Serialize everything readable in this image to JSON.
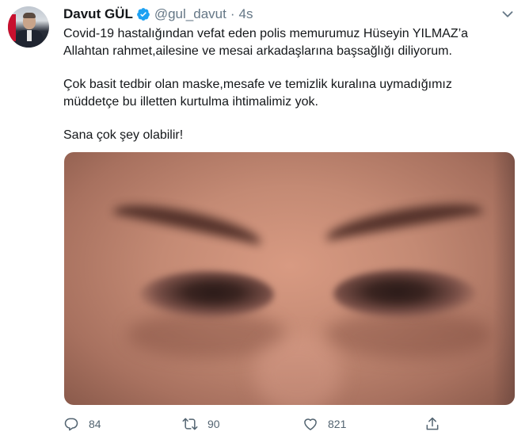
{
  "author": {
    "name": "Davut GÜL",
    "handle": "@gul_davut",
    "separator": "·",
    "time": "4s",
    "verified": true,
    "avatar_icon": "profile-photo-icon"
  },
  "tweet": {
    "lines": [
      "Covid-19 hastalığından vefat eden polis memurumuz Hüseyin YILMAZ’a",
      "Allahtan rahmet,ailesine ve mesai arkadaşlarına başsağlığı diliyorum.",
      "Çok basit tedbir olan maske,mesafe ve temizlik kuralına uymadığımız",
      "müddetçe bu illetten kurtulma ihtimalimiz yok.",
      "Sana çok şey olabilir!"
    ]
  },
  "media": {
    "description_icon": "photo-eyes-icon"
  },
  "actions": {
    "replies": "84",
    "retweets": "90",
    "likes": "821"
  },
  "colors": {
    "text": "#14171a",
    "muted": "#657786",
    "verified": "#1da1f2"
  }
}
